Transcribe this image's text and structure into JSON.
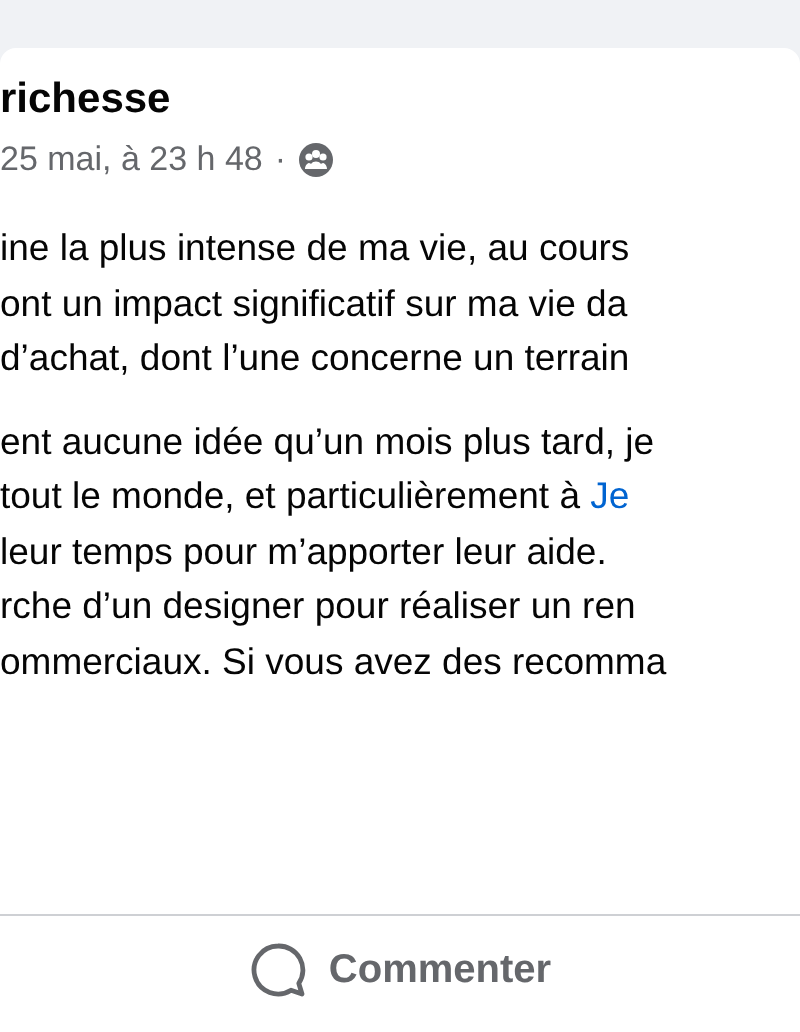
{
  "post": {
    "author": "richesse",
    "time": "25 mai, à 23 h 48",
    "separator": "·"
  },
  "paragraphs": [
    [
      {
        "text": "ine la plus intense de ma vie, au cours"
      },
      {
        "text": "ont un impact significatif sur ma vie da"
      },
      {
        "text": "d’achat, dont l’une concerne un terrain"
      }
    ],
    [
      {
        "text": "ent aucune idée qu’un mois plus tard, je"
      },
      {
        "text": "tout le monde, et particulièrement à ",
        "link": "Je"
      },
      {
        "text": "leur temps pour m’apporter leur aide."
      },
      {
        "text": "rche d’un designer pour réaliser un ren"
      },
      {
        "text": "ommerciaux. Si vous avez des recomma"
      }
    ]
  ],
  "actions": [
    {
      "label": "Commenter"
    }
  ]
}
